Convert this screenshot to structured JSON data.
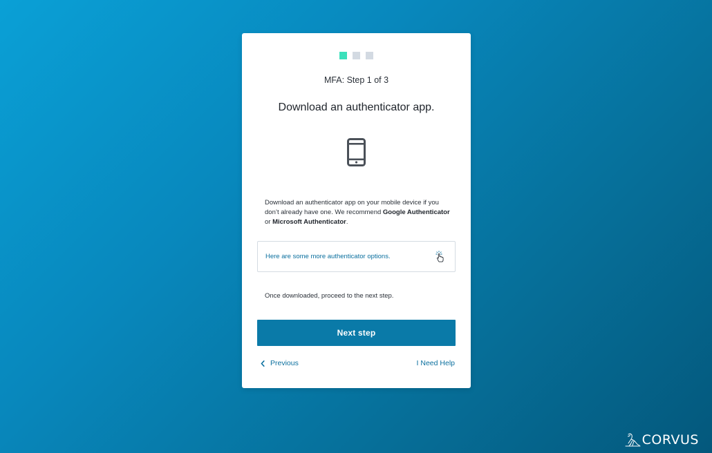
{
  "progress": {
    "total_steps": 3,
    "current_step": 1,
    "active_color": "#3be0bb",
    "inactive_color": "#d3dae2"
  },
  "step_label": "MFA: Step 1 of 3",
  "heading": "Download an authenticator app.",
  "icons": {
    "device": "mobile-phone-icon",
    "options": "pointer-hand-icon",
    "previous": "chevron-left-icon",
    "brand": "crow-logo-icon"
  },
  "description": {
    "part1": "Download an authenticator app on your mobile device if you don’t already have one. We recommend ",
    "app1": "Google Authenticator",
    "part2": " or ",
    "app2": "Microsoft Authenticator",
    "part3": "."
  },
  "options_link": "Here are some more authenticator options.",
  "once_text": "Once downloaded, proceed to the next step.",
  "next_button": "Next step",
  "previous_link": "Previous",
  "help_link": "I Need Help",
  "brand": "CORVUS",
  "colors": {
    "primary": "#0a7aa8",
    "link": "#0a6f9e",
    "background_start": "#0aa0d6",
    "background_end": "#04587c"
  }
}
